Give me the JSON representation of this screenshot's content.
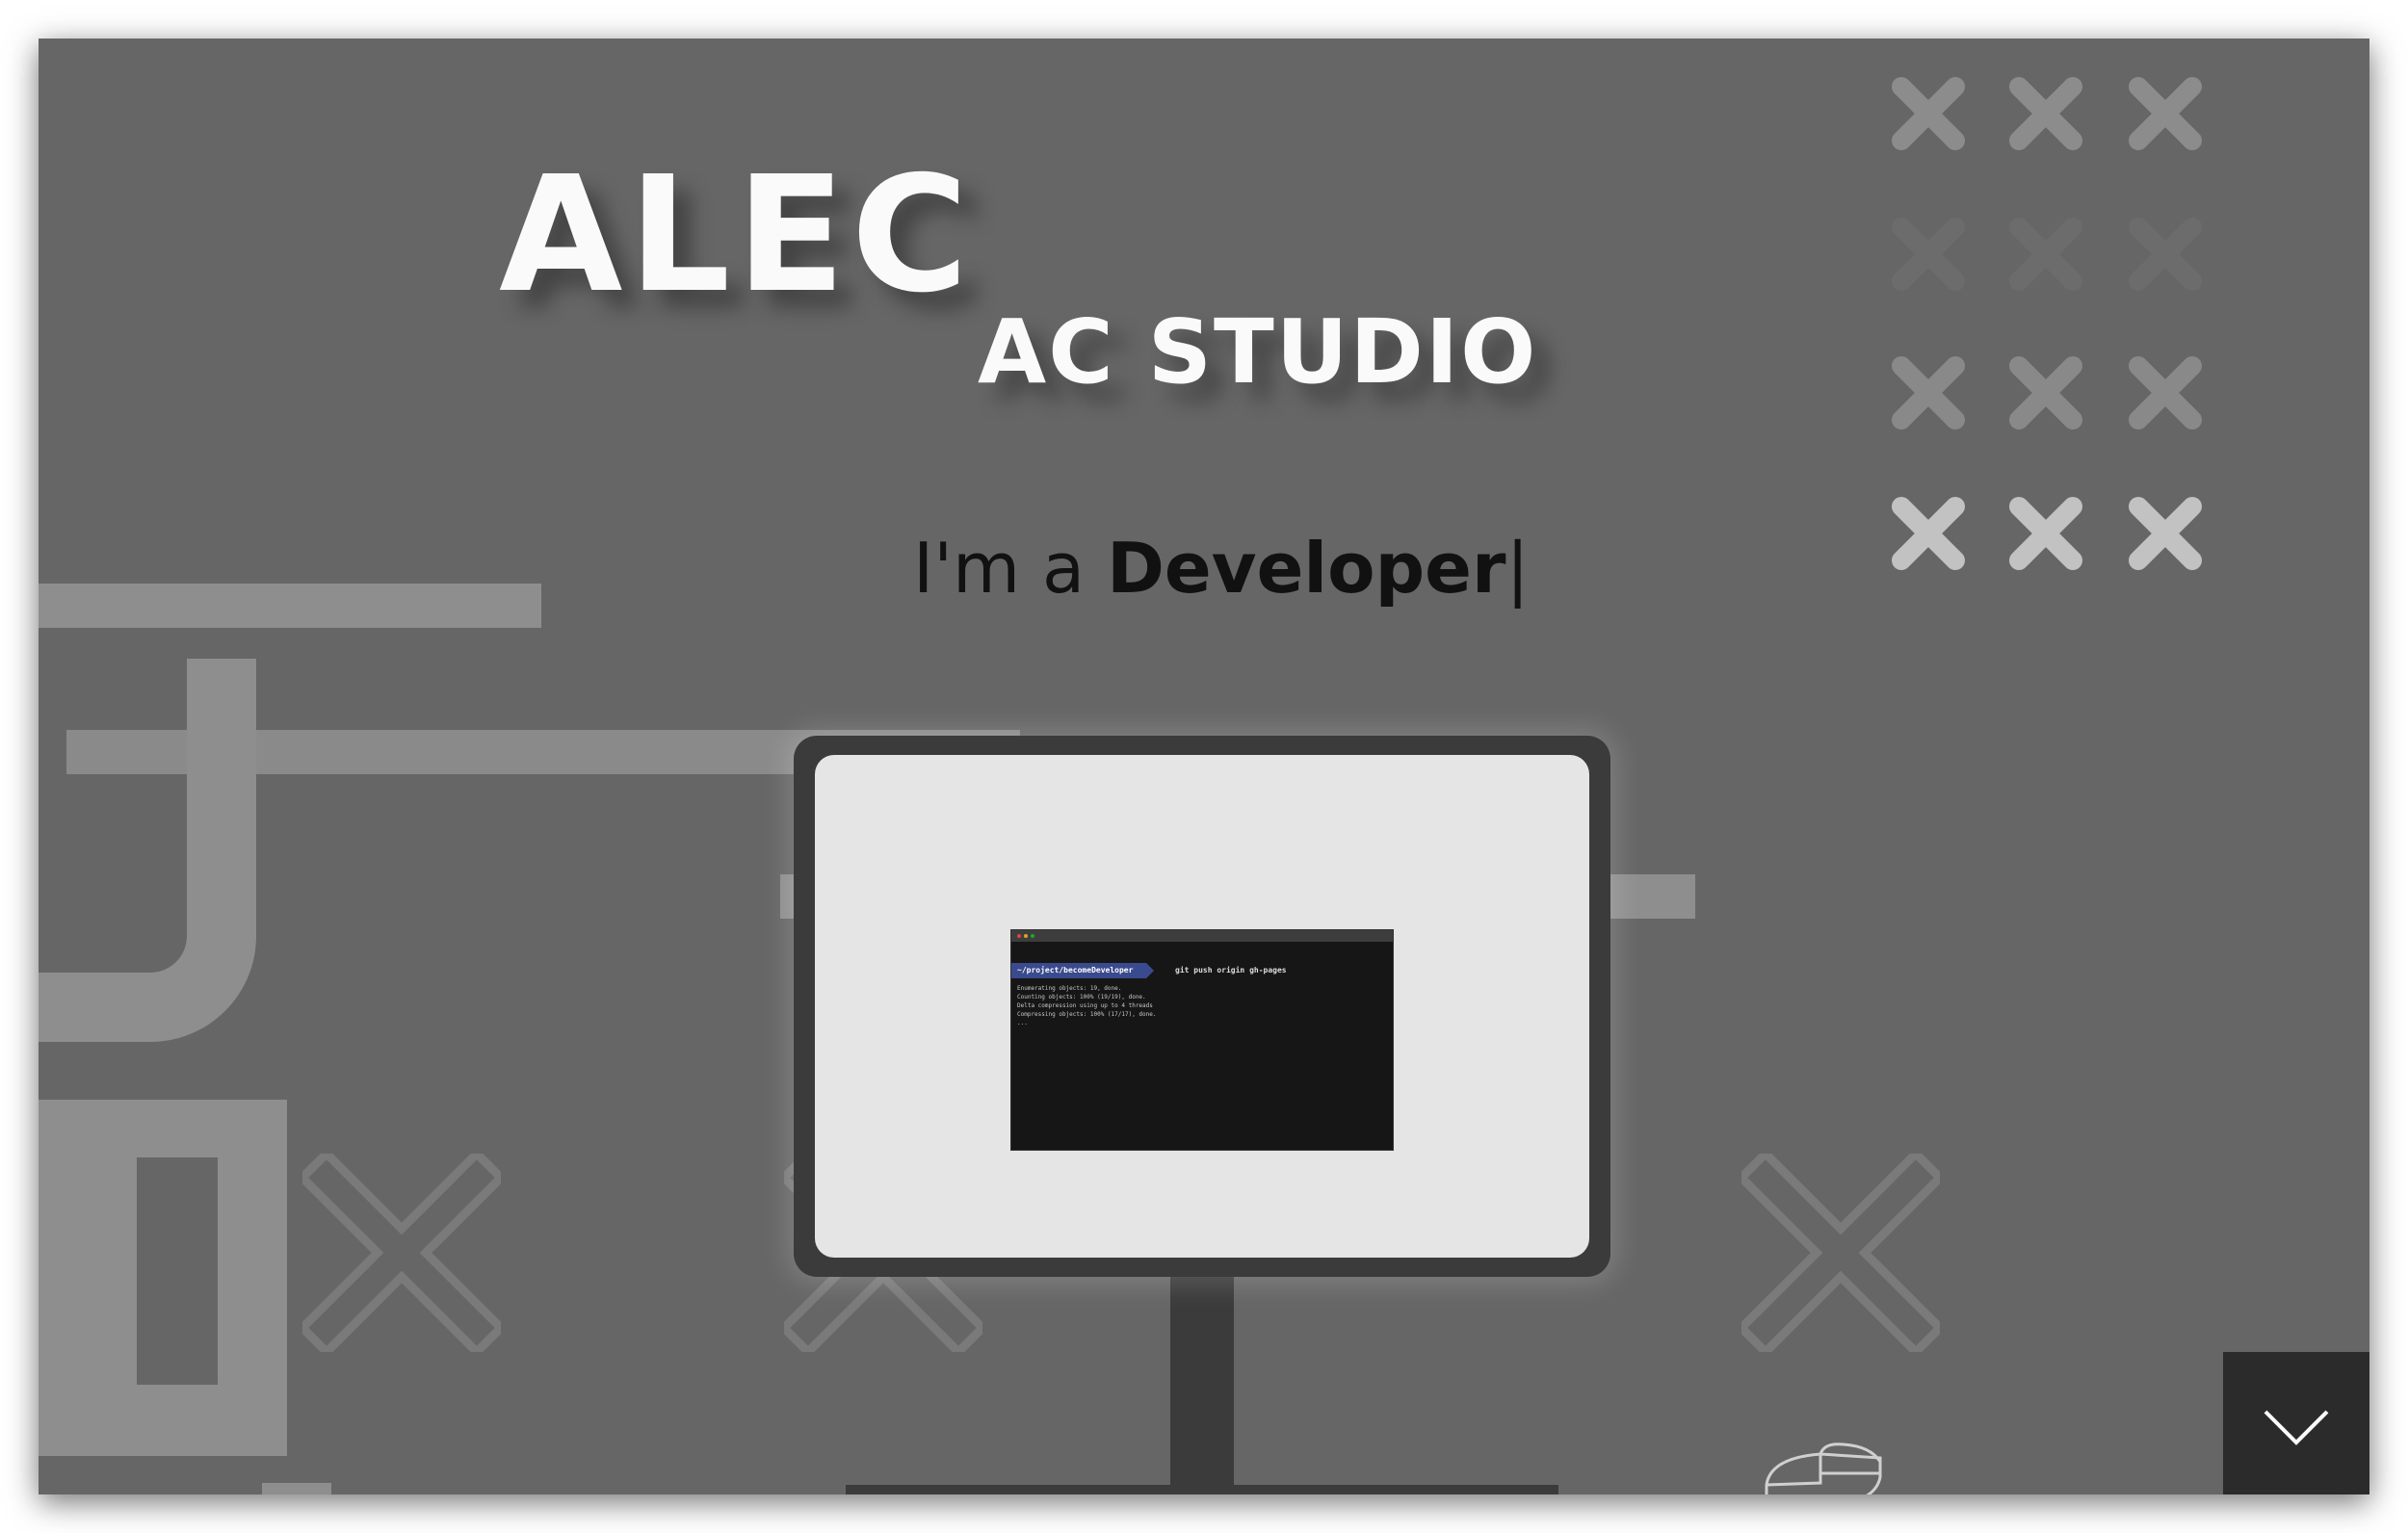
{
  "hero": {
    "brand_name": "ALEC",
    "studio_name": "AC STUDIO",
    "tagline_prefix": "I'm a ",
    "tagline_role": "Developer",
    "cursor": "|"
  },
  "terminal": {
    "prompt_path": "~/project/becomeDeveloper",
    "command": "git push origin gh-pages",
    "output_lines": [
      "Enumerating objects: 19, done.",
      "Counting objects: 100% (19/19), done.",
      "Delta compression using up to 4 threads",
      "Compressing objects: 100% (17/17), done.",
      "..."
    ]
  },
  "icons": {
    "scroll_down": "chevron-down-icon",
    "mouse": "mouse-icon",
    "decor": "x-icon"
  },
  "colors": {
    "background": "#666666",
    "title": "#fafafa",
    "tagline": "#111111",
    "monitor_frame": "#3b3b3b",
    "screen": "#e5e5e5",
    "terminal_bg": "#161616",
    "prompt_bg": "#3a4a8e",
    "decor": "#8e8e8e",
    "scroll_button": "#2b2b2b"
  }
}
